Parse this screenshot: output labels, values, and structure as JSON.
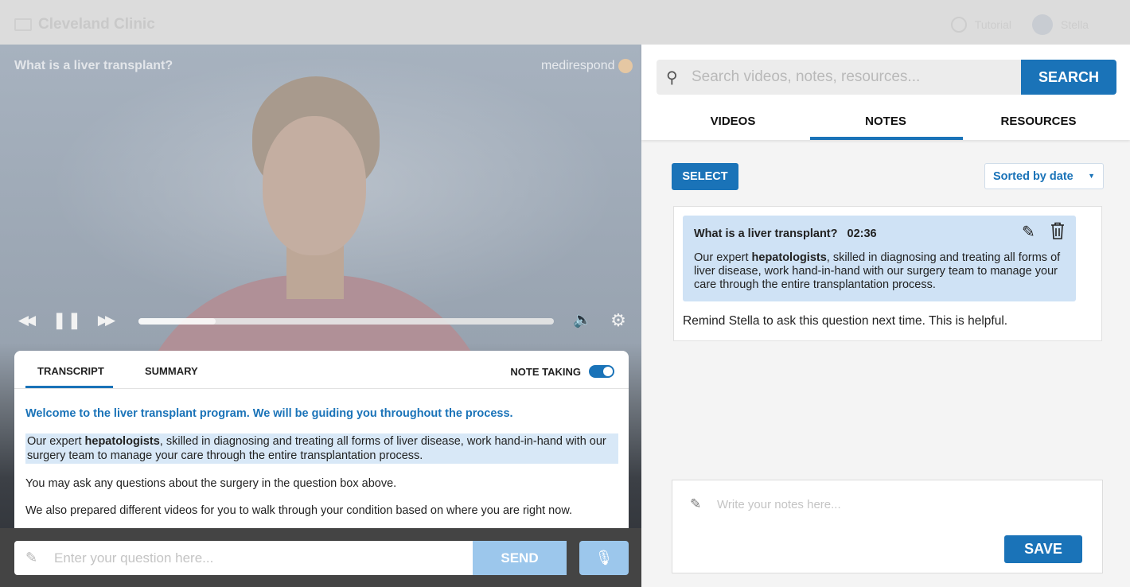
{
  "topbar": {
    "brand_name": "Cleveland Clinic",
    "help_label": "Tutorial",
    "user_label": "Stella"
  },
  "video": {
    "title": "What is a liver transplant?",
    "logo_text": "medirespond",
    "progress": 0.185
  },
  "transcript": {
    "tabs": [
      "TRANSCRIPT",
      "SUMMARY"
    ],
    "note_taking_label": "NOTE TAKING",
    "note_taking_on": true,
    "welcome": "Welcome to the liver transplant program. We will be guiding you throughout the process.",
    "hl_prefix": "Our expert ",
    "hl_bold": "hepatologists",
    "hl_suffix": ", skilled in diagnosing and treating all forms of liver disease, work hand-in-hand with our surgery team to manage your care through the entire transplantation process.",
    "para_2": "You may ask any questions about the surgery in the question box above.",
    "para_3": "We also prepared different videos for you to walk through your condition based on where you are right now."
  },
  "question": {
    "placeholder": "Enter your question here...",
    "send_label": "SEND"
  },
  "right": {
    "search_placeholder": "Search videos, notes, resources...",
    "search_label": "SEARCH",
    "tabs": [
      "VIDEOS",
      "NOTES",
      "RESOURCES"
    ],
    "active_tab": "NOTES",
    "select_label": "SELECT",
    "sort_label": "Sorted by date",
    "note": {
      "title": "What is a liver transplant?",
      "time": "02:36",
      "text_prefix": "Our expert ",
      "text_bold": "hepatologists",
      "text_suffix": ", skilled in diagnosing and treating all forms of liver disease, work hand-in-hand with our surgery team to manage your care through the entire transplantation process.",
      "comment": "Remind Stella to ask this question next time. This is helpful."
    },
    "write_placeholder": "Write your notes here...",
    "save_label": "SAVE"
  },
  "colors": {
    "accent": "#1a73b8",
    "accent_light": "#9cc7ec",
    "highlight": "#cfe2f5"
  },
  "icons": [
    "search-icon",
    "pencil-icon",
    "trash-icon",
    "rewind-icon",
    "pause-icon",
    "fast-forward-icon",
    "volume-icon",
    "gear-icon",
    "microphone-icon",
    "chevron-down-icon"
  ]
}
